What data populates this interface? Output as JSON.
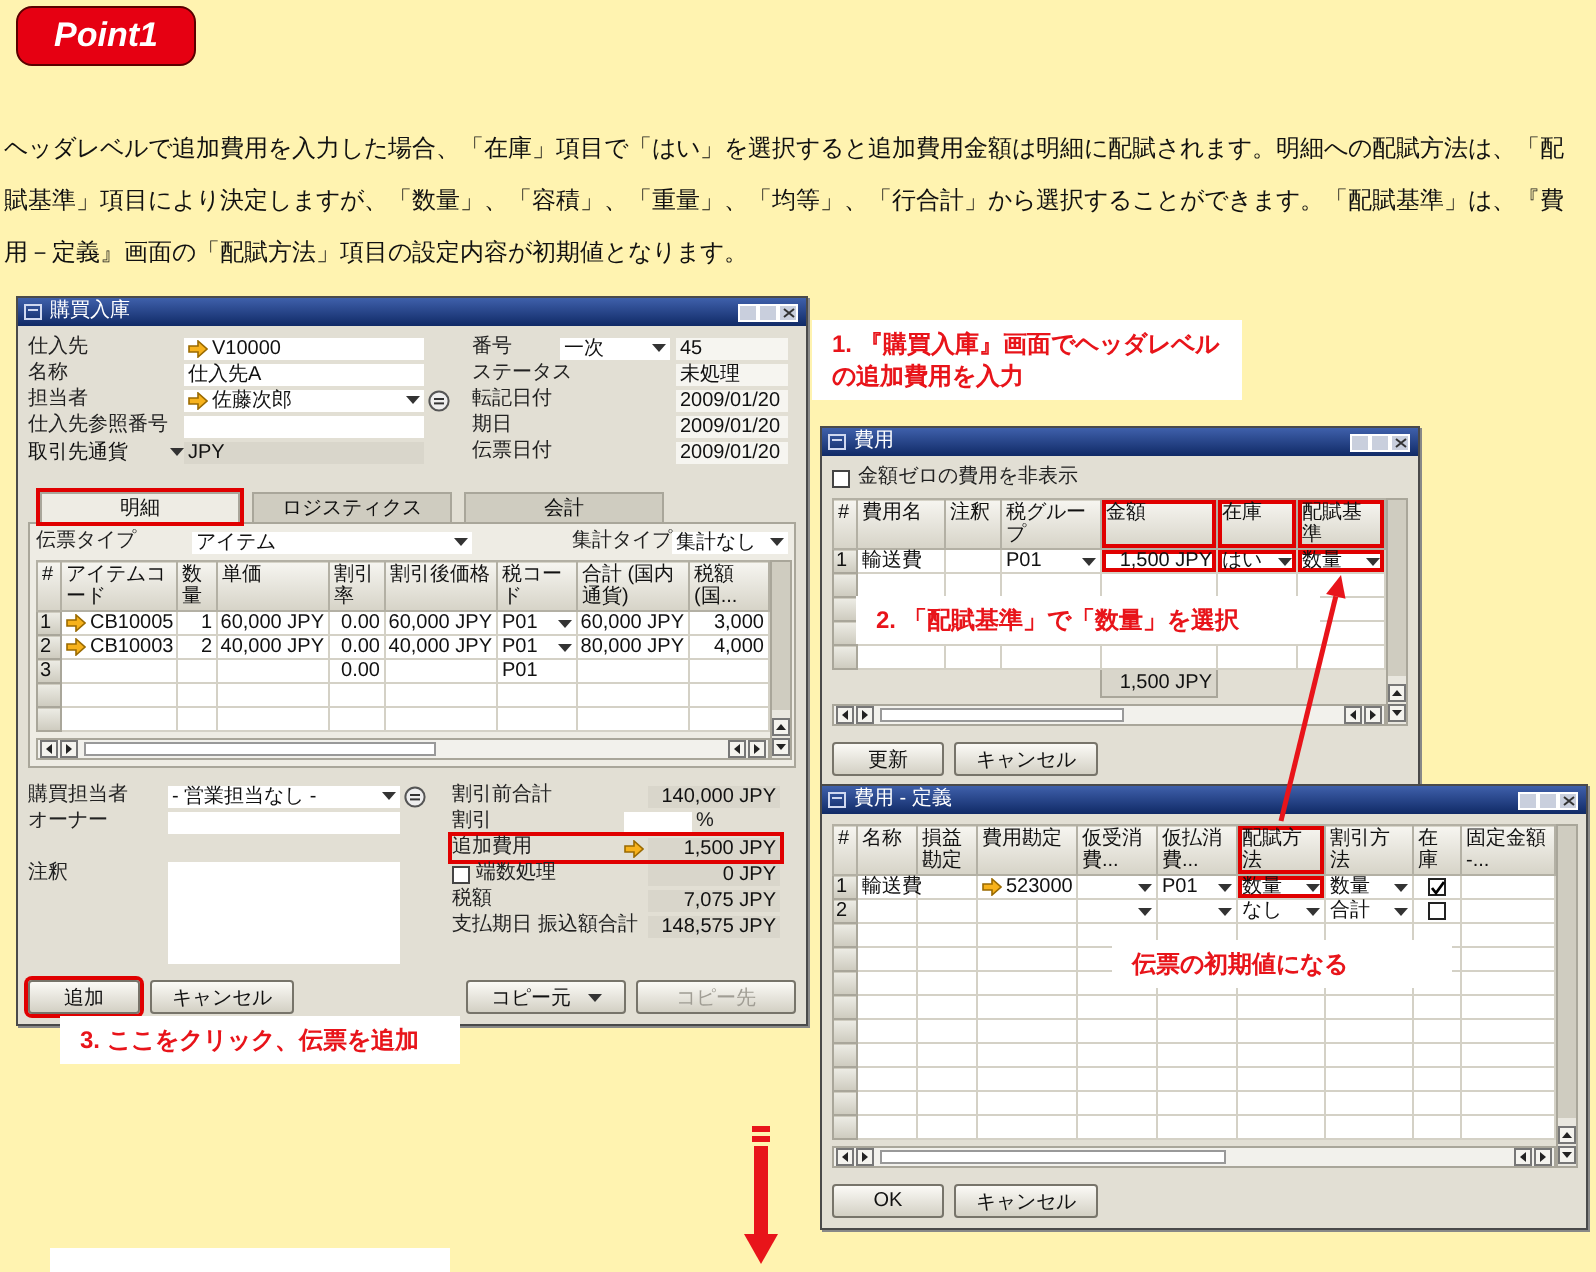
{
  "badge": "Point1",
  "intro": "ヘッダレベルで追加費用を入力した場合、「在庫」項目で「はい」を選択すると追加費用金額は明細に配賦されます。明細への配賦方法は、「配賦基準」項目により決定しますが、「数量」、「容積」、「重量」、「均等」、「行合計」から選択することができます。「配賦基準」は、『費用－定義』画面の「配賦方法」項目の設定内容が初期値となります。",
  "purchase_window": {
    "title": "購買入庫",
    "header_left": [
      {
        "label": "仕入先",
        "value": "V10000",
        "kind": "link"
      },
      {
        "label": "名称",
        "value": "仕入先A",
        "kind": "text"
      },
      {
        "label": "担当者",
        "value": "佐藤次郎",
        "kind": "contact"
      },
      {
        "label": "仕入先参照番号",
        "kind": "empty"
      },
      {
        "label": "取引先通貨",
        "value": "JPY",
        "kind": "currency"
      }
    ],
    "header_right": [
      {
        "label": "番号",
        "series": "一次",
        "value": "45",
        "kind": "series"
      },
      {
        "label": "ステータス",
        "value": "未処理",
        "kind": "text"
      },
      {
        "label": "転記日付",
        "value": "2009/01/20",
        "kind": "text"
      },
      {
        "label": "期日",
        "value": "2009/01/20",
        "kind": "text"
      },
      {
        "label": "伝票日付",
        "value": "2009/01/20",
        "kind": "text"
      }
    ],
    "tabs": [
      {
        "label": "明細",
        "selected": true,
        "highlighted": true
      },
      {
        "label": "ロジスティクス",
        "selected": false,
        "highlighted": false
      },
      {
        "label": "会計",
        "selected": false,
        "highlighted": false
      }
    ],
    "document_type": {
      "label": "伝票タイプ",
      "value": "アイテム"
    },
    "summary_type": {
      "label": "集計タイプ",
      "value": "集計なし"
    },
    "grid": {
      "number_header": "#",
      "columns": [
        {
          "title": "アイテムコード",
          "kind": "link",
          "highlighted": false
        },
        {
          "title": "数量",
          "kind": "text",
          "highlighted": false
        },
        {
          "title": "単価",
          "kind": "text",
          "highlighted": false
        },
        {
          "title": "割引率",
          "kind": "text",
          "highlighted": false
        },
        {
          "title": "割引後価格",
          "kind": "text",
          "highlighted": false
        },
        {
          "title": "税コード",
          "kind": "dropdown",
          "highlighted": false
        },
        {
          "title": "合計 (国内通貨)",
          "kind": "text",
          "highlighted": false
        },
        {
          "title": "税額 (国...",
          "kind": "text",
          "highlighted": false
        }
      ],
      "rows": [
        {
          "number": "1",
          "editable": true,
          "cells": [
            "CB10005",
            "1",
            "60,000 JPY",
            "0.00",
            "60,000 JPY",
            "P01",
            "60,000 JPY",
            "3,000"
          ]
        },
        {
          "number": "2",
          "editable": true,
          "cells": [
            "CB10003",
            "2",
            "40,000 JPY",
            "0.00",
            "40,000 JPY",
            "P01",
            "80,000 JPY",
            "4,000"
          ]
        },
        {
          "number": "3",
          "editable": false,
          "cells": [
            null,
            null,
            null,
            "0.00",
            null,
            "P01",
            null,
            null
          ]
        }
      ]
    },
    "footer_left": [
      {
        "label": "購買担当者",
        "value": "- 営業担当なし -",
        "kind": "dropdown"
      },
      {
        "label": "オーナー",
        "kind": "field"
      },
      {
        "label": "注釈",
        "kind": "memo"
      }
    ],
    "totals": [
      {
        "label": "割引前合計",
        "value": "140,000 JPY",
        "kind": "amount",
        "highlighted": false
      },
      {
        "label": "割引",
        "suffix": "%",
        "kind": "percent",
        "highlighted": false
      },
      {
        "label": "追加費用",
        "value": "1,500 JPY",
        "kind": "link",
        "highlighted": true
      },
      {
        "label": "端数処理",
        "value": "0 JPY",
        "kind": "check",
        "checked": false,
        "highlighted": false
      },
      {
        "label": "税額",
        "value": "7,075 JPY",
        "kind": "amount",
        "highlighted": false
      },
      {
        "label": "支払期日 振込額合計",
        "value": "148,575 JPY",
        "kind": "amount",
        "highlighted": false
      }
    ],
    "buttons": [
      {
        "label": "追加",
        "kind": "button",
        "highlighted": true,
        "disabled": false
      },
      {
        "label": "キャンセル",
        "kind": "button",
        "highlighted": false,
        "disabled": false
      },
      {
        "label": "コピー元",
        "kind": "split",
        "highlighted": false,
        "disabled": false
      },
      {
        "label": "コピー先",
        "kind": "button",
        "highlighted": false,
        "disabled": true
      }
    ]
  },
  "fee_window": {
    "title": "費用",
    "hide_zero": {
      "label": "金額ゼロの費用を非表示",
      "checked": false
    },
    "grid": {
      "number_header": "#",
      "columns": [
        {
          "title": "費用名",
          "kind": "text",
          "highlighted": false
        },
        {
          "title": "注釈",
          "kind": "text",
          "highlighted": false
        },
        {
          "title": "税グループ",
          "kind": "dropdown",
          "highlighted": false
        },
        {
          "title": "金額",
          "kind": "text",
          "highlighted": true,
          "total": "1,500 JPY"
        },
        {
          "title": "在庫",
          "kind": "dropdown",
          "highlighted": true
        },
        {
          "title": "配賦基準",
          "kind": "dropdown",
          "highlighted": true
        }
      ],
      "rows": [
        {
          "number": "1",
          "editable": true,
          "cells": [
            "輸送費",
            null,
            "P01",
            "1,500 JPY",
            "はい",
            "数量"
          ]
        }
      ]
    },
    "buttons": [
      {
        "label": "更新",
        "kind": "button",
        "highlighted": false,
        "disabled": false
      },
      {
        "label": "キャンセル",
        "kind": "button",
        "highlighted": false,
        "disabled": false
      }
    ]
  },
  "define_window": {
    "title": "費用 - 定義",
    "grid": {
      "number_header": "#",
      "columns": [
        {
          "title": "名称",
          "kind": "text",
          "highlighted": false
        },
        {
          "title": "損益勘定",
          "kind": "text",
          "highlighted": false
        },
        {
          "title": "費用勘定",
          "kind": "link",
          "highlighted": false
        },
        {
          "title": "仮受消費...",
          "kind": "dropdown",
          "highlighted": false
        },
        {
          "title": "仮払消費...",
          "kind": "dropdown",
          "highlighted": false
        },
        {
          "title": "配賦方法",
          "kind": "dropdown",
          "highlighted": true
        },
        {
          "title": "割引方法",
          "kind": "dropdown",
          "highlighted": false
        },
        {
          "title": "在庫",
          "kind": "check",
          "highlighted": false
        },
        {
          "title": "固定金額 -...",
          "kind": "text",
          "highlighted": false
        }
      ],
      "rows": [
        {
          "number": "1",
          "editable": true,
          "cells": [
            "輸送費",
            null,
            "523000",
            null,
            "P01",
            "数量",
            "数量",
            true,
            null
          ]
        },
        {
          "number": "2",
          "editable": true,
          "cells": [
            null,
            null,
            null,
            null,
            null,
            "なし",
            "合計",
            false,
            null
          ]
        }
      ]
    },
    "buttons": [
      {
        "label": "OK",
        "kind": "button",
        "highlighted": false,
        "disabled": false
      },
      {
        "label": "キャンセル",
        "kind": "button",
        "highlighted": false,
        "disabled": false
      }
    ]
  },
  "callouts": [
    {
      "text": "1. 『購買入庫』画面でヘッダレベルの追加費用を入力"
    },
    {
      "text": "2. 「配賦基準」で「数量」を選択"
    },
    {
      "text": "伝票の初期値になる"
    },
    {
      "text": "3. ここをクリック、伝票を追加"
    }
  ]
}
